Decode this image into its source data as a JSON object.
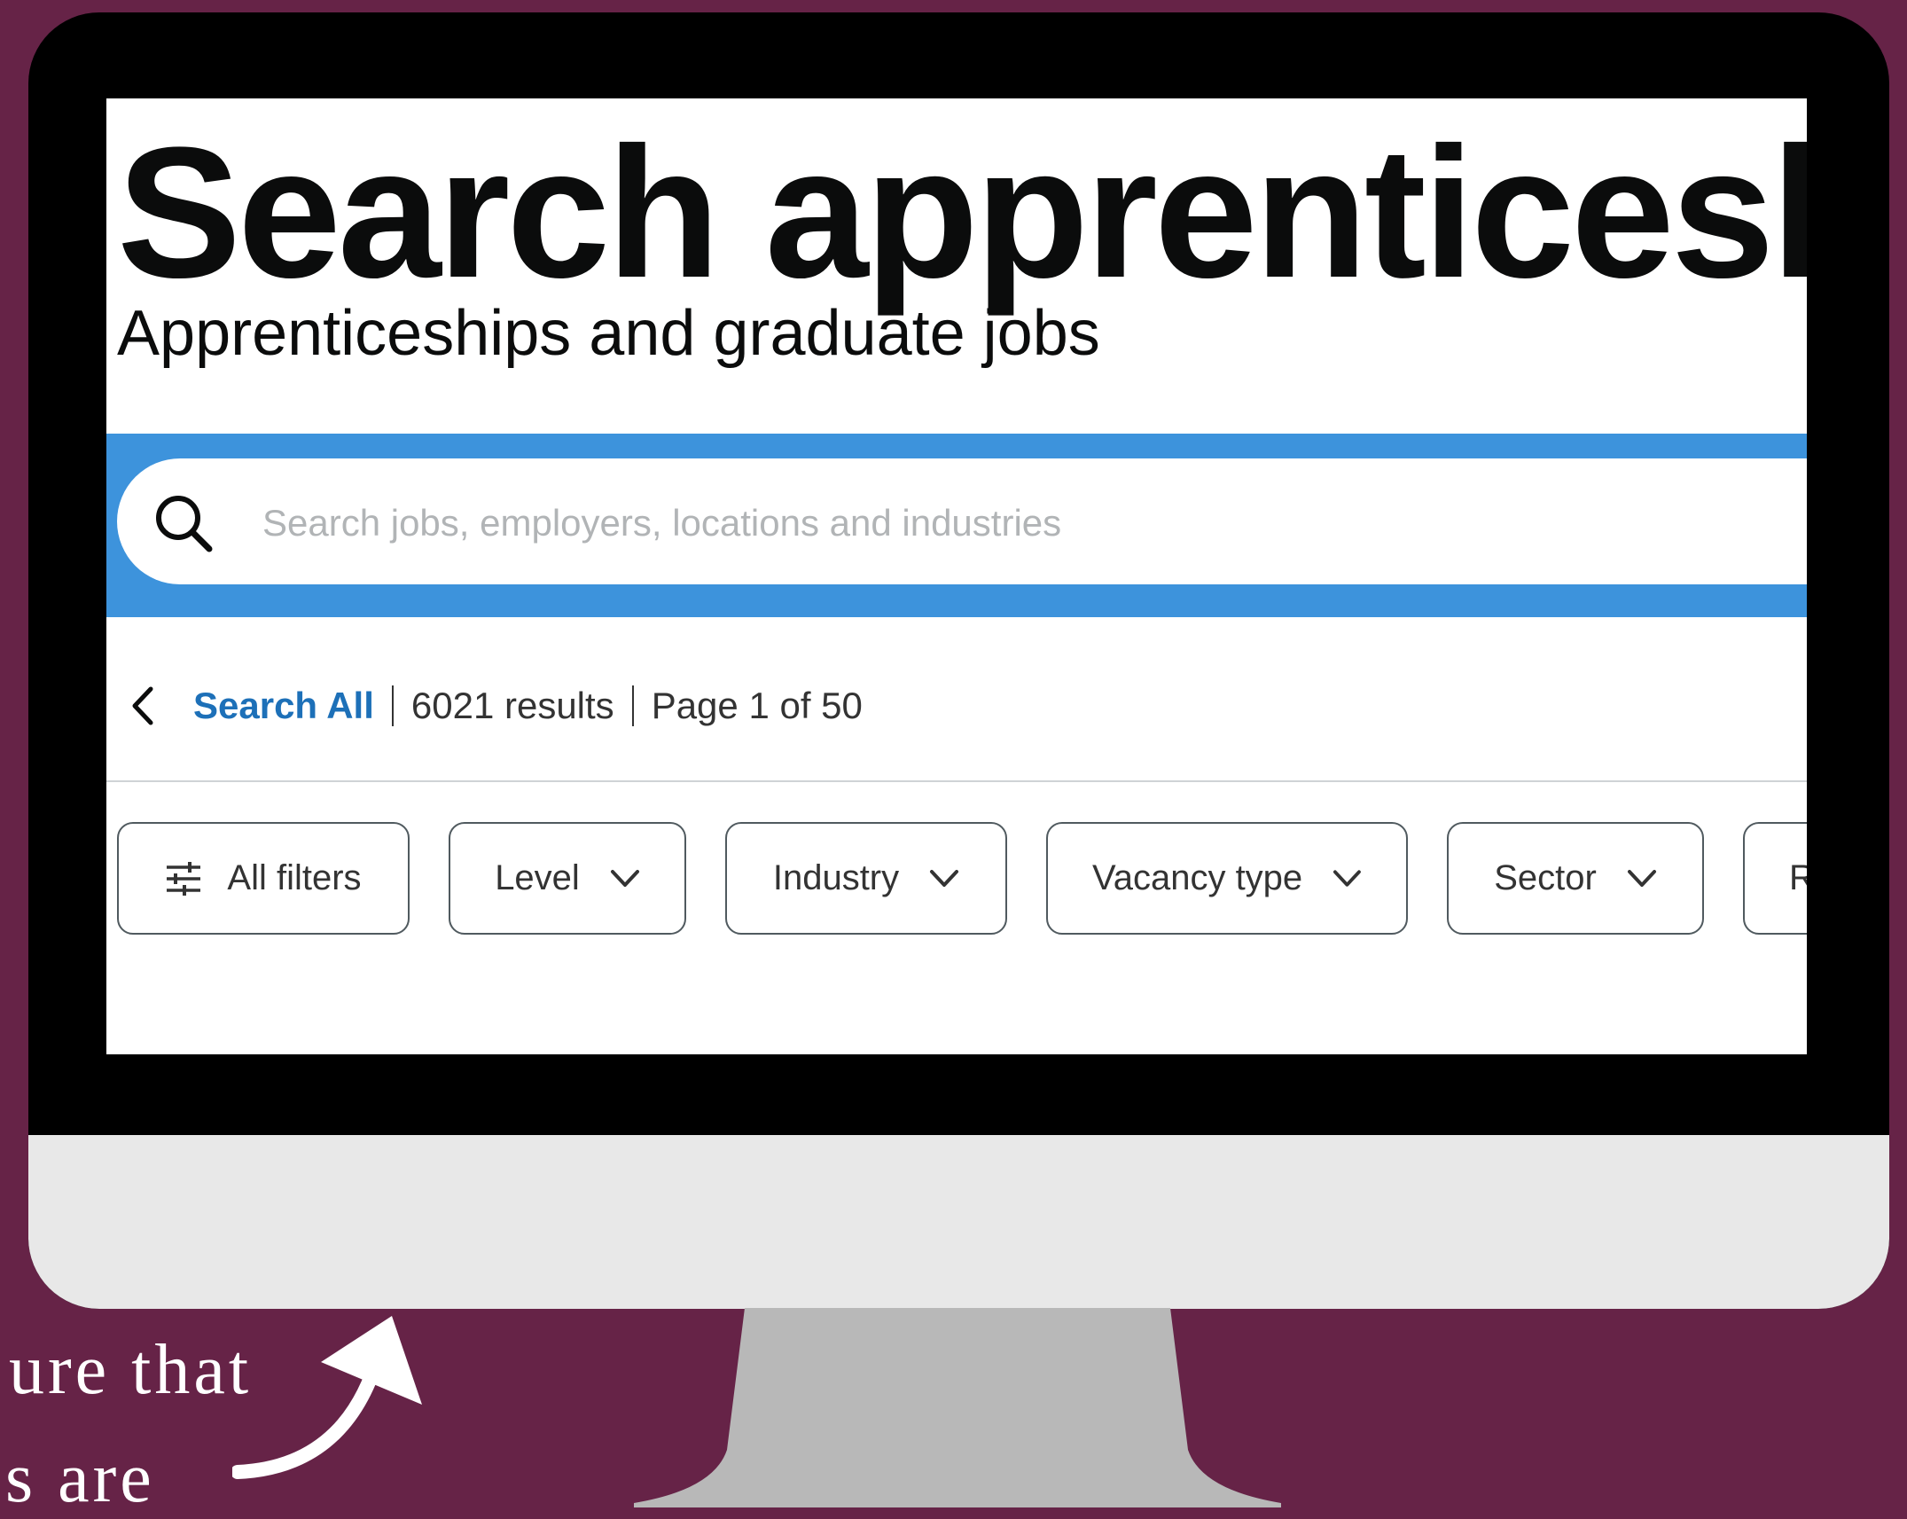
{
  "page": {
    "title": "Search apprenticeship",
    "subtitle": "Apprenticeships and graduate jobs"
  },
  "search": {
    "placeholder": "Search jobs, employers, locations and industries",
    "value": ""
  },
  "results": {
    "back_link": "Search All",
    "count": "6021 results",
    "pagination": "Page 1 of 50"
  },
  "filters": {
    "all_filters": "All filters",
    "level": "Level",
    "industry": "Industry",
    "vacancy_type": "Vacancy type",
    "sector": "Sector",
    "partial": "R"
  },
  "caption": {
    "line1": "ure that",
    "line2": "s are"
  },
  "colors": {
    "background": "#662347",
    "search_band": "#3d93dc",
    "link": "#1d70b8"
  },
  "icons": [
    "search-icon",
    "chevron-left-icon",
    "sliders-icon",
    "chevron-down-icon",
    "curved-arrow-icon"
  ]
}
